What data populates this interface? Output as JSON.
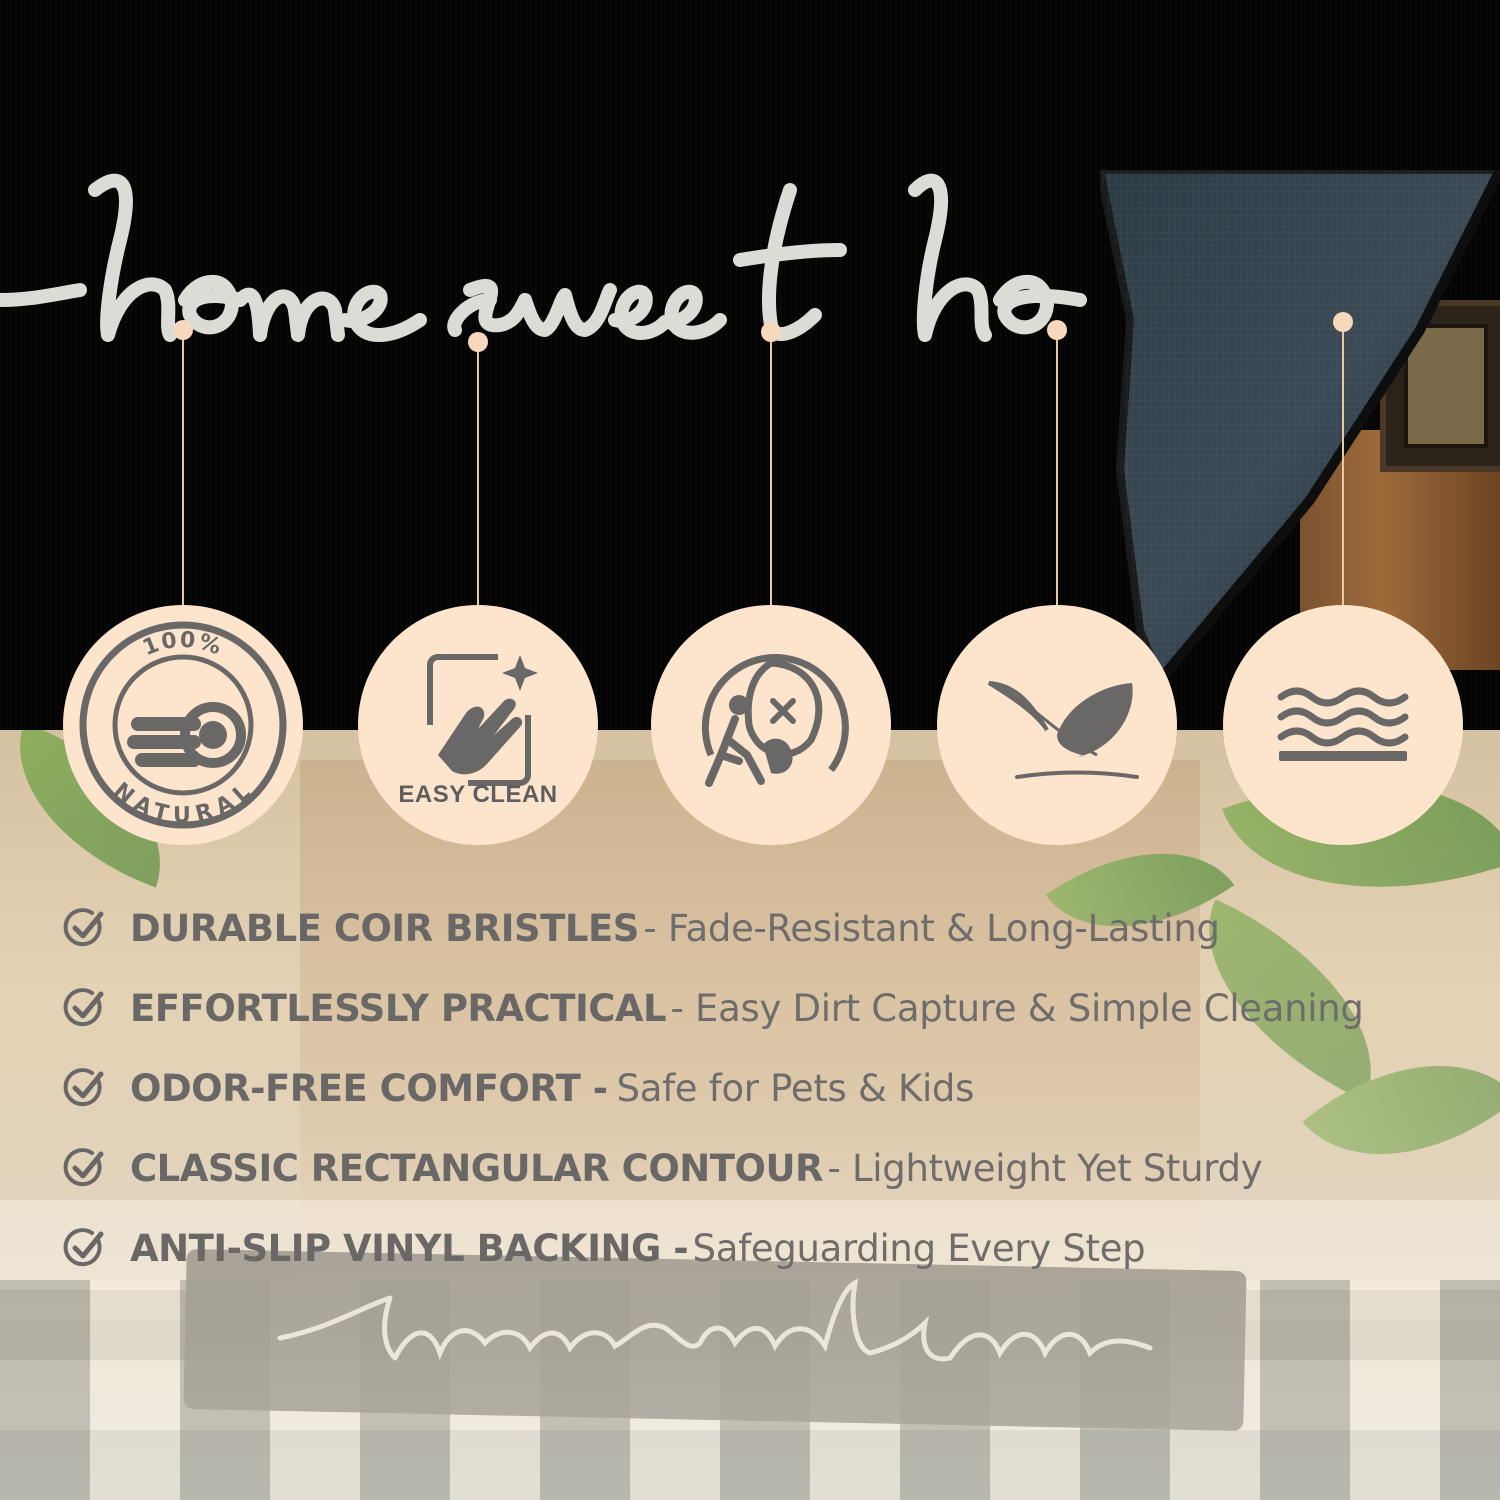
{
  "mat_text": "home sweet home",
  "colors": {
    "badge_fill": "#fde4cc",
    "icon_gray": "#6a6867",
    "connector": "#e8c9a6",
    "mat_black": "#040404",
    "text_gray": "#6a6867"
  },
  "features": [
    {
      "icon": "coconut-natural-icon",
      "top_text": "100%",
      "bottom_text": "NATURAL"
    },
    {
      "icon": "easy-clean-hand-icon",
      "caption": "EASY CLEAN"
    },
    {
      "icon": "safe-for-pets-kids-icon"
    },
    {
      "icon": "feather-lightweight-icon"
    },
    {
      "icon": "waves-layers-icon"
    }
  ],
  "benefits": [
    {
      "title": "DURABLE COIR BRISTLES",
      "desc": "- Fade-Resistant & Long-Lasting"
    },
    {
      "title": "EFFORTLESSLY PRACTICAL",
      "desc": "- Easy Dirt Capture & Simple Cleaning"
    },
    {
      "title": "ODOR-FREE COMFORT -",
      "desc": "Safe for Pets & Kids"
    },
    {
      "title": "CLASSIC RECTANGULAR CONTOUR",
      "desc": "- Lightweight Yet Sturdy"
    },
    {
      "title": "ANTI-SLIP VINYL BACKING -",
      "desc": "Safeguarding Every Step"
    }
  ]
}
